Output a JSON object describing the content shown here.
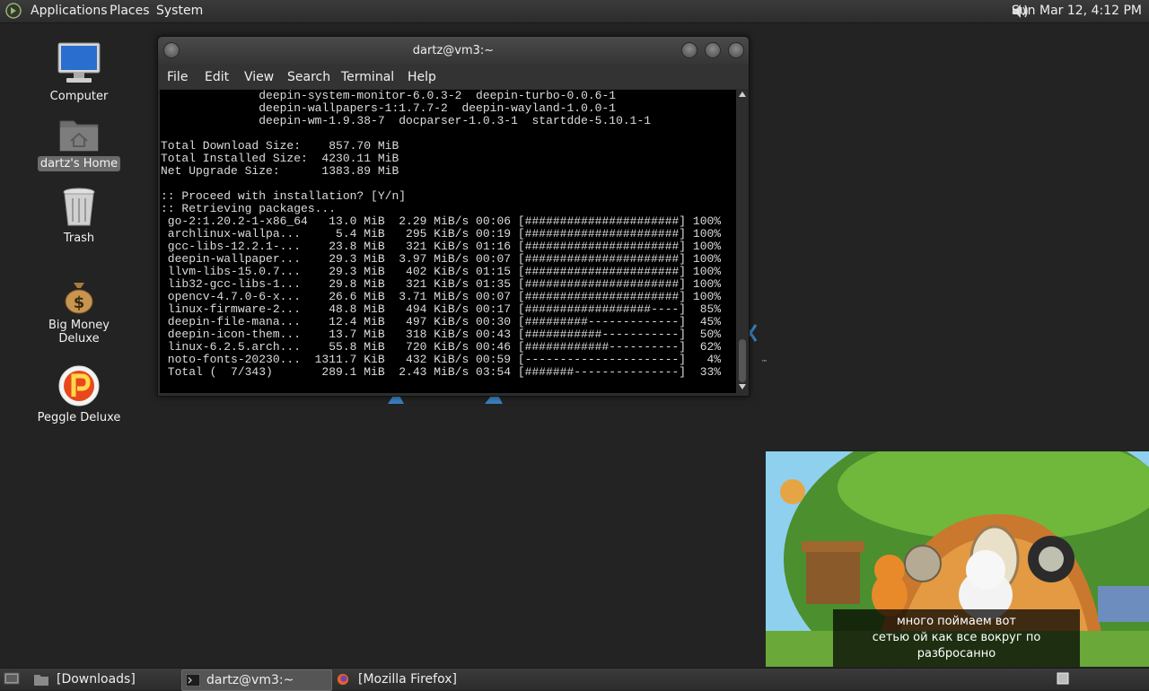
{
  "top_panel": {
    "menus": [
      "Applications",
      "Places",
      "System"
    ],
    "clock": "Sun Mar 12,  4:12 PM",
    "icons": {
      "logo": "app-menu-logo-icon",
      "volume": "speaker-volume-icon"
    }
  },
  "desktop": {
    "icons": [
      {
        "label": "Computer",
        "icon": "computer-monitor-icon"
      },
      {
        "label": "dartz's Home",
        "icon": "home-folder-icon",
        "selected": true
      },
      {
        "label": "Trash",
        "icon": "trash-can-icon"
      },
      {
        "label": "Big Money Deluxe",
        "icon": "money-bag-icon"
      },
      {
        "label": "Peggle Deluxe",
        "icon": "peggle-ball-icon"
      }
    ]
  },
  "terminal": {
    "title": "dartz@vm3:~",
    "menu": [
      "File",
      "Edit",
      "View",
      "Search",
      "Terminal",
      "Help"
    ],
    "lines": [
      "              deepin-system-monitor-6.0.3-2  deepin-turbo-0.0.6-1",
      "              deepin-wallpapers-1:1.7.7-2  deepin-wayland-1.0.0-1",
      "              deepin-wm-1.9.38-7  docparser-1.0.3-1  startdde-5.10.1-1",
      "",
      "Total Download Size:    857.70 MiB",
      "Total Installed Size:  4230.11 MiB",
      "Net Upgrade Size:      1383.89 MiB",
      "",
      ":: Proceed with installation? [Y/n]",
      ":: Retrieving packages...",
      " go-2:1.20.2-1-x86_64   13.0 MiB  2.29 MiB/s 00:06 [######################] 100%",
      " archlinux-wallpa...     5.4 MiB   295 KiB/s 00:19 [######################] 100%",
      " gcc-libs-12.2.1-...    23.8 MiB   321 KiB/s 01:16 [######################] 100%",
      " deepin-wallpaper...    29.3 MiB  3.97 MiB/s 00:07 [######################] 100%",
      " llvm-libs-15.0.7...    29.3 MiB   402 KiB/s 01:15 [######################] 100%",
      " lib32-gcc-libs-1...    29.8 MiB   321 KiB/s 01:35 [######################] 100%",
      " opencv-4.7.0-6-x...    26.6 MiB  3.71 MiB/s 00:07 [######################] 100%",
      " linux-firmware-2...    48.8 MiB   494 KiB/s 00:17 [##################----]  85%",
      " deepin-file-mana...    12.4 MiB   497 KiB/s 00:30 [#########-------------]  45%",
      " deepin-icon-them...    13.7 MiB   318 KiB/s 00:43 [###########-----------]  50%",
      " linux-6.2.5.arch...    55.8 MiB   720 KiB/s 00:46 [############----------]  62%",
      " noto-fonts-20230...  1311.7 KiB   432 KiB/s 00:59 [----------------------]   4%",
      " Total (  7/343)       289.1 MiB  2.43 MiB/s 03:54 [#######---------------]  33%"
    ]
  },
  "video": {
    "subtitle_lines": [
      "много поймаем вот",
      "сетью ой как все вокруг по разбросанно"
    ]
  },
  "taskbar": {
    "tasks": [
      {
        "label": "[Downloads]",
        "icon": "folder-icon"
      },
      {
        "label": "dartz@vm3:~",
        "icon": "terminal-icon",
        "active": true
      },
      {
        "label": "[Mozilla Firefox]",
        "icon": "firefox-icon"
      }
    ],
    "icons": {
      "show_desktop": "show-desktop-icon",
      "workspace": "workspace-switcher-icon"
    }
  },
  "colors": {
    "panel": "#2f302f",
    "desktop": "#222322",
    "terminal_bg": "#000000",
    "terminal_fg": "#dcdcdc"
  }
}
